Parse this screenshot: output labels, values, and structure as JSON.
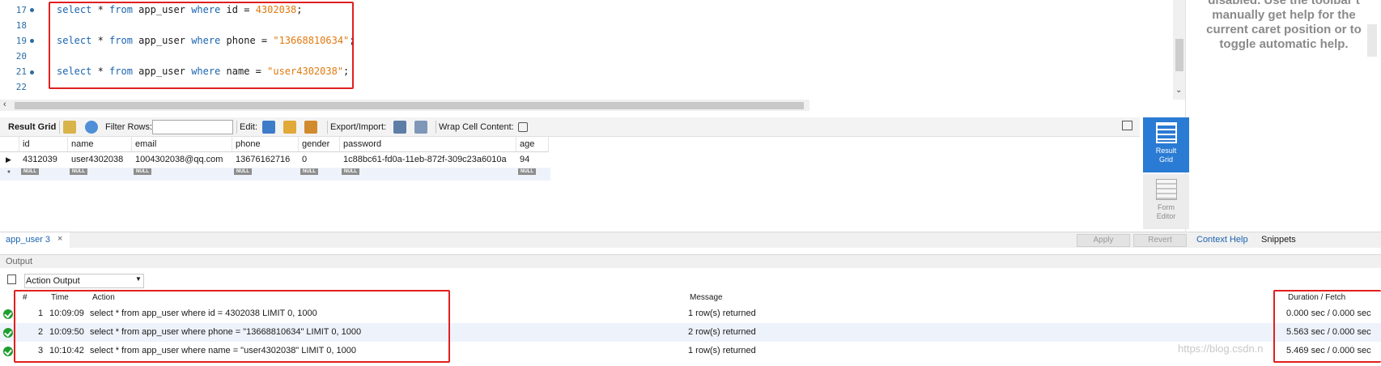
{
  "editor": {
    "lines": [
      {
        "num": "17",
        "marker": true,
        "parts": [
          [
            "kw",
            "select"
          ],
          [
            "txt",
            " * "
          ],
          [
            "kw",
            "from"
          ],
          [
            "txt",
            " app_user "
          ],
          [
            "kw",
            "where"
          ],
          [
            "txt",
            " id = "
          ],
          [
            "num",
            "4302038"
          ],
          [
            "txt",
            ";"
          ]
        ]
      },
      {
        "num": "18",
        "marker": false,
        "parts": []
      },
      {
        "num": "19",
        "marker": true,
        "parts": [
          [
            "kw",
            "select"
          ],
          [
            "txt",
            " * "
          ],
          [
            "kw",
            "from"
          ],
          [
            "txt",
            " app_user "
          ],
          [
            "kw",
            "where"
          ],
          [
            "txt",
            " phone = "
          ],
          [
            "str",
            "\"13668810634\""
          ],
          [
            "txt",
            ";"
          ]
        ]
      },
      {
        "num": "20",
        "marker": false,
        "parts": []
      },
      {
        "num": "21",
        "marker": true,
        "parts": [
          [
            "kw",
            "select"
          ],
          [
            "txt",
            " * "
          ],
          [
            "kw",
            "from"
          ],
          [
            "txt",
            " app_user "
          ],
          [
            "kw",
            "where"
          ],
          [
            "txt",
            " name = "
          ],
          [
            "str",
            "\"user4302038\""
          ],
          [
            "txt",
            ";"
          ]
        ]
      },
      {
        "num": "22",
        "marker": false,
        "parts": []
      }
    ]
  },
  "help": {
    "lines": [
      "disabled. Use the toolbar t",
      "manually get help for the",
      "current caret position or to",
      "toggle automatic help."
    ]
  },
  "result_toolbar": {
    "result_grid": "Result Grid",
    "filter_rows": "Filter Rows:",
    "edit": "Edit:",
    "export_import": "Export/Import:",
    "wrap_cell": "Wrap Cell Content:"
  },
  "grid": {
    "columns": [
      "id",
      "name",
      "email",
      "phone",
      "gender",
      "password",
      "age"
    ],
    "row": [
      "4312039",
      "user4302038",
      "1004302038@qq.com",
      "13676162716",
      "0",
      "1c88bc61-fd0a-11eb-872f-309c23a6010a",
      "94"
    ],
    "null_label": "NULL"
  },
  "side_panel": {
    "result_grid_line1": "Result",
    "result_grid_line2": "Grid",
    "form_editor_line1": "Form",
    "form_editor_line2": "Editor"
  },
  "tabs": {
    "active_tab": "app_user 3",
    "apply": "Apply",
    "revert": "Revert",
    "context_help": "Context Help",
    "snippets": "Snippets"
  },
  "output": {
    "header": "Output",
    "selector": "Action Output",
    "columns": {
      "num": "#",
      "time": "Time",
      "action": "Action",
      "message": "Message",
      "duration": "Duration / Fetch"
    },
    "rows": [
      {
        "num": "1",
        "time": "10:09:09",
        "action": "select * from app_user where id = 4302038 LIMIT 0, 1000",
        "message": "1 row(s) returned",
        "duration": "0.000 sec / 0.000 sec"
      },
      {
        "num": "2",
        "time": "10:09:50",
        "action": "select * from app_user where phone = \"13668810634\" LIMIT 0, 1000",
        "message": "2 row(s) returned",
        "duration": "5.563 sec / 0.000 sec"
      },
      {
        "num": "3",
        "time": "10:10:42",
        "action": "select * from app_user where name = \"user4302038\" LIMIT 0, 1000",
        "message": "1 row(s) returned",
        "duration": "5.469 sec / 0.000 sec"
      }
    ]
  },
  "watermark": "https://blog.csdn.n"
}
